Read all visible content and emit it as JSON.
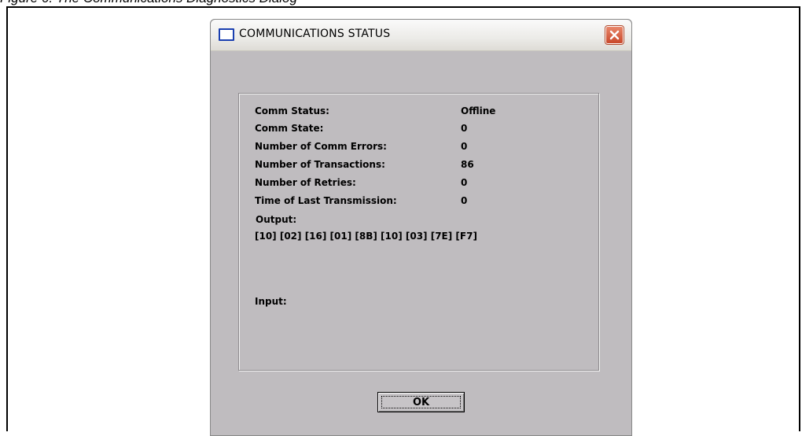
{
  "document": {
    "caption": "Figure 6. The Communications Diagnostics Dialog"
  },
  "window": {
    "title": "COMMUNICATIONS STATUS",
    "icons": {
      "app": "window-icon",
      "close": "close-icon"
    }
  },
  "status": {
    "rows": [
      {
        "label": "Comm Status:",
        "value": "Offline"
      },
      {
        "label": "Comm State:",
        "value": "0"
      },
      {
        "label": "Number of Comm Errors:",
        "value": "0"
      },
      {
        "label": "Number of Transactions:",
        "value": "86"
      },
      {
        "label": "Number of Retries:",
        "value": "0"
      },
      {
        "label": "Time of Last Transmission:",
        "value": "0"
      }
    ],
    "output_label": "Output:",
    "output_value": "[10] [02] [16] [01] [8B] [10] [03] [7E] [F7]",
    "input_label": "Input:",
    "input_value": ""
  },
  "buttons": {
    "ok_label": "OK"
  },
  "colors": {
    "dialog_bg": "#bfbcbf",
    "close_button": "#c9482a",
    "app_icon": "#1a3fb0"
  }
}
